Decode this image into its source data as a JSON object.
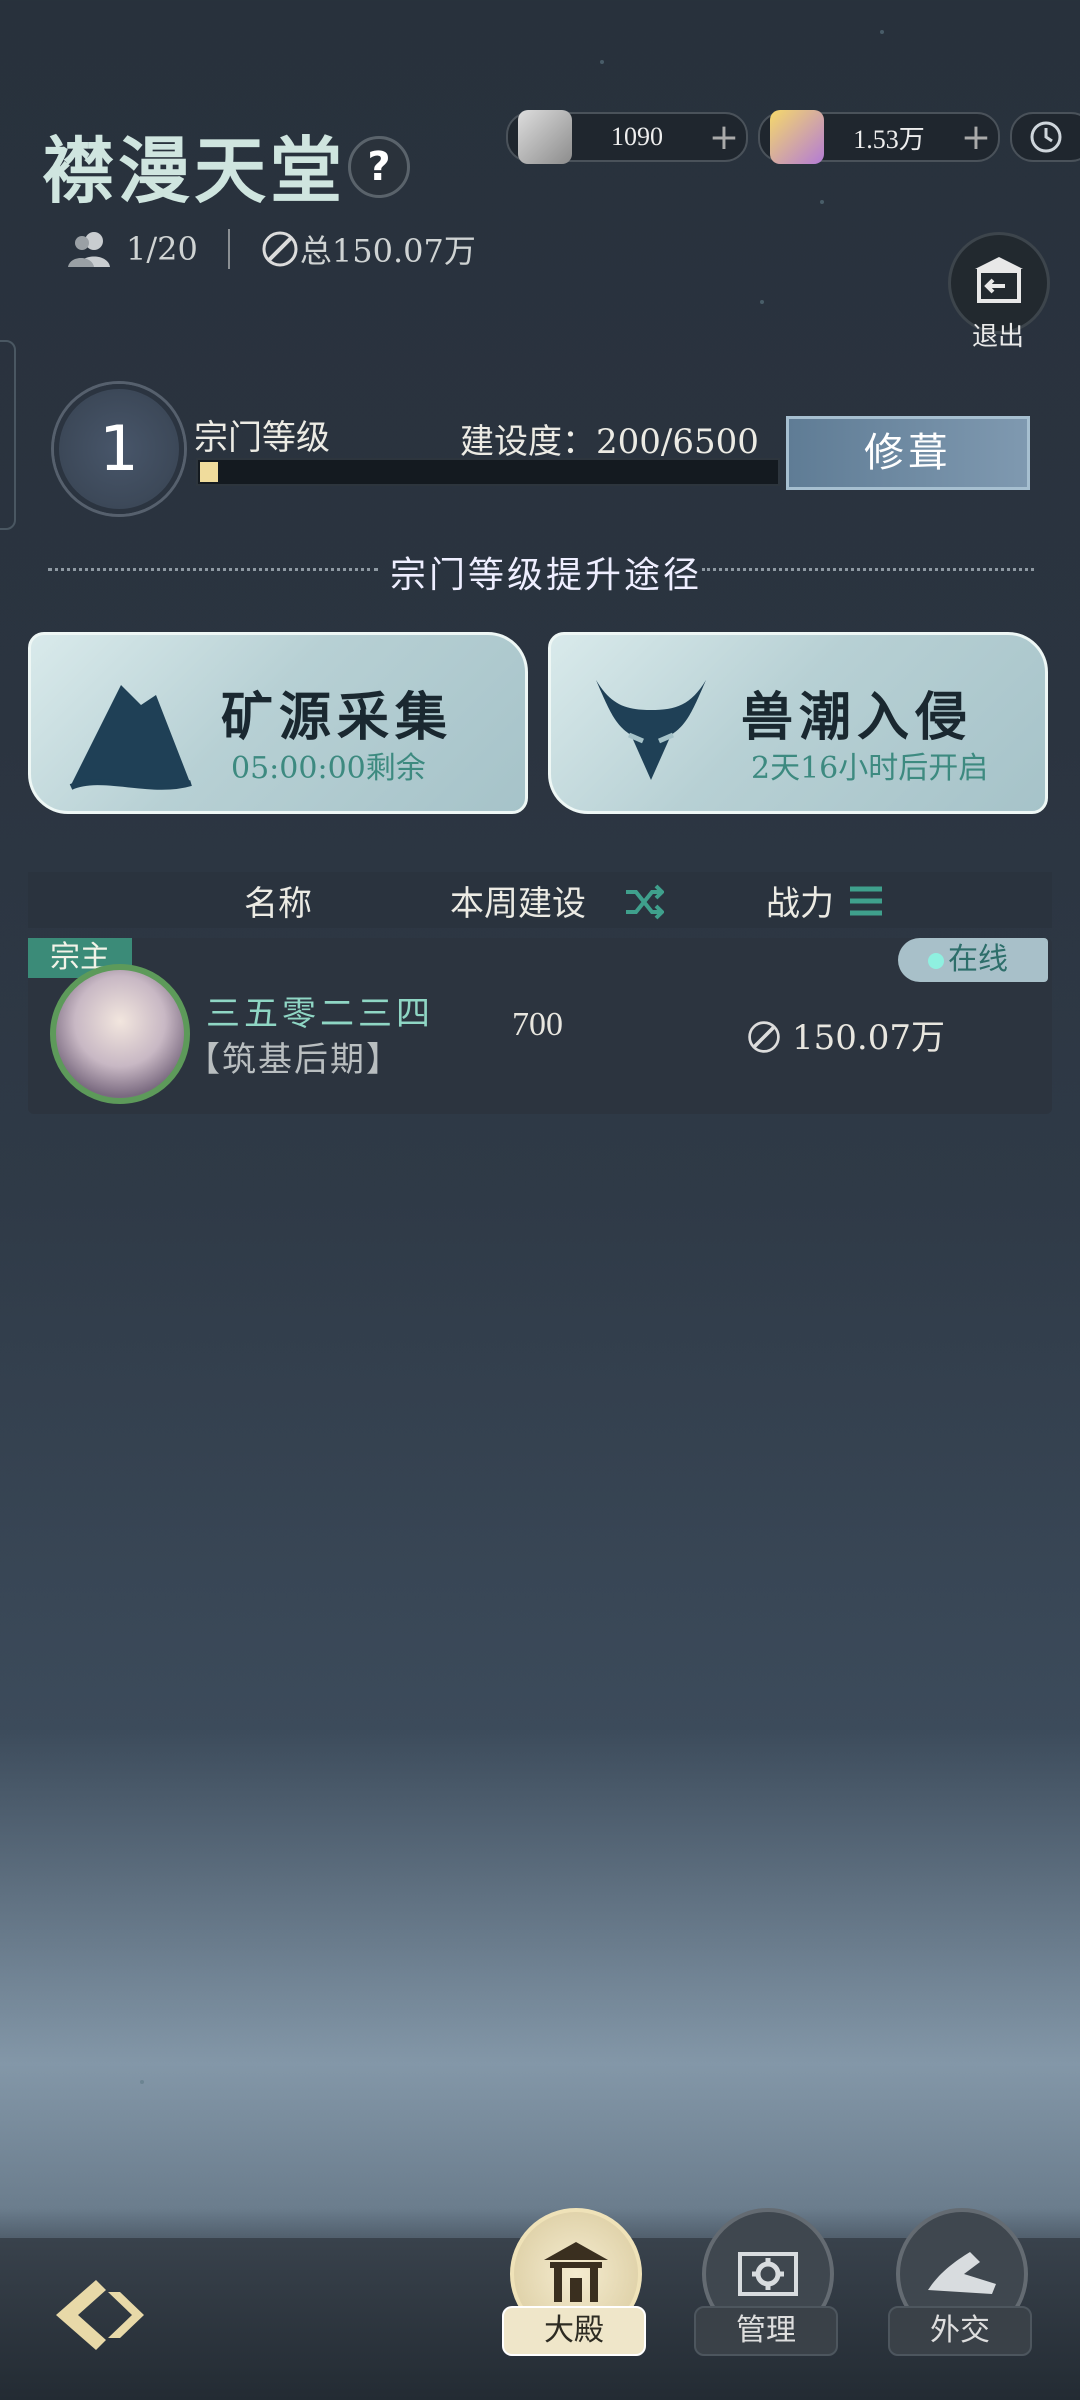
{
  "header": {
    "title": "襟漫天堂",
    "help_icon": "question-icon",
    "resources": [
      {
        "icon": "scroll-resource-icon",
        "value": "1090"
      },
      {
        "icon": "purple-gem-icon",
        "value": "1.53万"
      }
    ],
    "members": "1/20",
    "total_power": "总150.07万",
    "exit_label": "退出"
  },
  "sect": {
    "level": "1",
    "level_label": "宗门等级",
    "build_label": "建设度：200/6500",
    "build_progress": 0.031,
    "repair_label": "修葺"
  },
  "routes": {
    "title": "宗门等级提升途径",
    "cards": [
      {
        "name": "矿源采集",
        "sub": "05:00:00剩余",
        "icon": "mountain-icon"
      },
      {
        "name": "兽潮入侵",
        "sub": "2天16小时后开启",
        "icon": "demon-mask-icon"
      }
    ]
  },
  "table": {
    "headers": {
      "name": "名称",
      "weekly": "本周建设",
      "power": "战力"
    },
    "rows": [
      {
        "role": "宗主",
        "status": "在线",
        "name": "三五零二三四",
        "rank": "【筑基后期】",
        "weekly": "700",
        "power": "150.07万"
      }
    ]
  },
  "bottom_nav": {
    "items": [
      {
        "label": "大殿",
        "icon": "hall-icon",
        "active": true
      },
      {
        "label": "管理",
        "icon": "gear-scroll-icon",
        "active": false
      },
      {
        "label": "外交",
        "icon": "handshake-icon",
        "active": false
      }
    ]
  },
  "colors": {
    "accent_teal": "#3b8b78",
    "bar_fill": "#f0dc9c",
    "name_teal": "#8fd6c4"
  }
}
